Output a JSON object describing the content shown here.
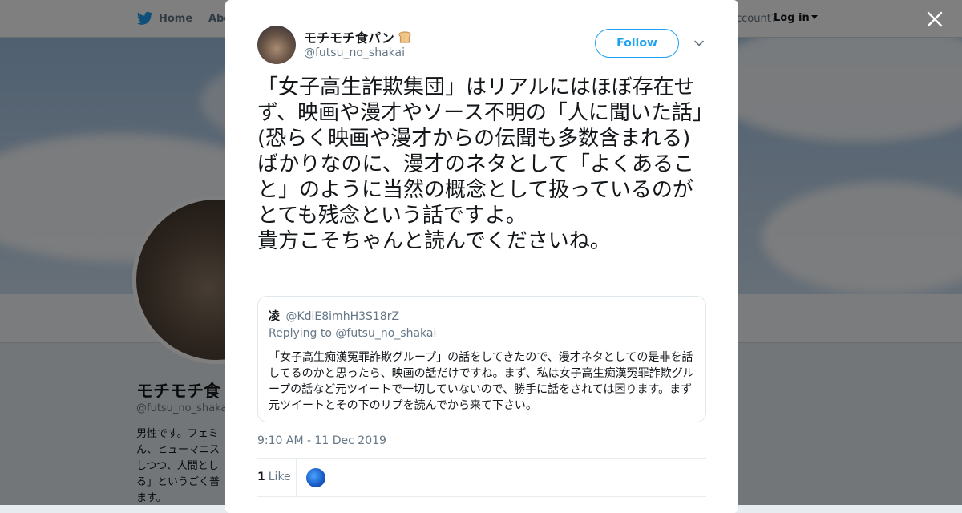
{
  "background": {
    "nav": {
      "home_label": "Home",
      "about_label": "Abo",
      "account_prompt": "ccount?",
      "login_label": "Log in"
    },
    "profile": {
      "name": "モチモチ食",
      "handle": "@futsu_no_shaka",
      "bio_lines": [
        "男性です。フェミ",
        "ん、ヒューマニス",
        "しつつ、人間とし",
        "る」というごく普",
        "ます。"
      ]
    }
  },
  "modal": {
    "author": {
      "name": "モチモチ食パン",
      "handle": "@futsu_no_shakai",
      "name_emoji_icon": "bread-icon"
    },
    "follow_label": "Follow",
    "tweet_text": "「女子高生詐欺集団」はリアルにはほぼ存在せず、映画や漫才やソース不明の「人に聞いた話」(恐らく映画や漫才からの伝聞も多数含まれる)ばかりなのに、漫才のネタとして「よくあること」のように当然の概念として扱っているのがとても残念という話ですよ。\n貴方こそちゃんと読んでくださいね。",
    "quote": {
      "name": "凌",
      "handle": "@KdiE8imhH3S18rZ",
      "replying_prefix": "Replying to",
      "replying_handle": "@futsu_no_shakai",
      "body": "「女子高生痴漢冤罪詐欺グループ」の話をしてきたので、漫才ネタとしての是非を話してるのかと思ったら、映画の話だけですね。まず、私は女子高生痴漢冤罪詐欺グループの話など元ツイートで一切していないので、勝手に話をされては困ります。まず元ツイートとその下のリプを読んでから来て下さい。"
    },
    "timestamp": "9:10 AM - 11 Dec 2019",
    "likes": {
      "count": "1",
      "label": "Like"
    }
  },
  "colors": {
    "accent": "#1da1f2",
    "text_primary": "#14171a",
    "text_secondary": "#657786",
    "overlay": "rgba(0,0,0,0.5)"
  }
}
